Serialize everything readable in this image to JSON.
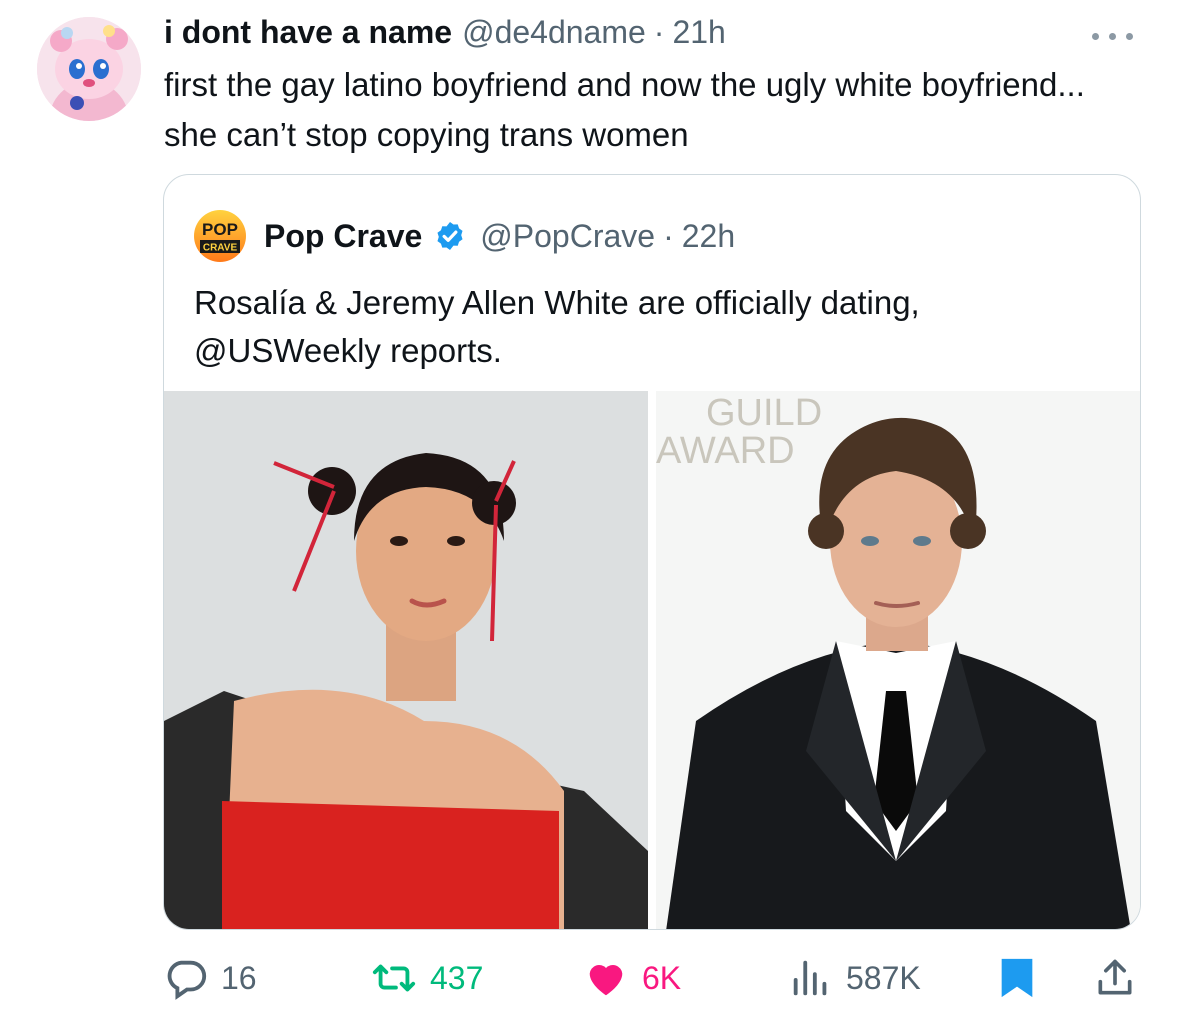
{
  "tweet": {
    "author_name": "i dont have a name",
    "handle": "@de4dname",
    "separator": "·",
    "time": "21h",
    "text": "first the gay latino boyfriend and now the ugly white boyfriend... she can’t stop copying trans women"
  },
  "quoted": {
    "author_name": "Pop Crave",
    "handle": "@PopCrave",
    "separator": "·",
    "time": "22h",
    "avatar_text_top": "POP",
    "avatar_text_bottom": "CRAVE",
    "text": "Rosalía & Jeremy Allen White are officially dating, @USWeekly reports.",
    "photo_backdrop_text_1": "GUILD",
    "photo_backdrop_text_2": "AWARD"
  },
  "actions": {
    "replies": "16",
    "reposts": "437",
    "likes": "6K",
    "views": "587K"
  },
  "colors": {
    "text": "#0f1419",
    "muted": "#536471",
    "repost_green": "#00ba7c",
    "like_pink": "#f91880",
    "bookmark_blue": "#1d9bf0",
    "verified_blue": "#1d9bf0",
    "border": "#cfd9de"
  },
  "icons": [
    "more-icon",
    "verified-badge-icon",
    "reply-icon",
    "repost-icon",
    "like-icon",
    "views-icon",
    "bookmark-icon",
    "share-icon"
  ]
}
